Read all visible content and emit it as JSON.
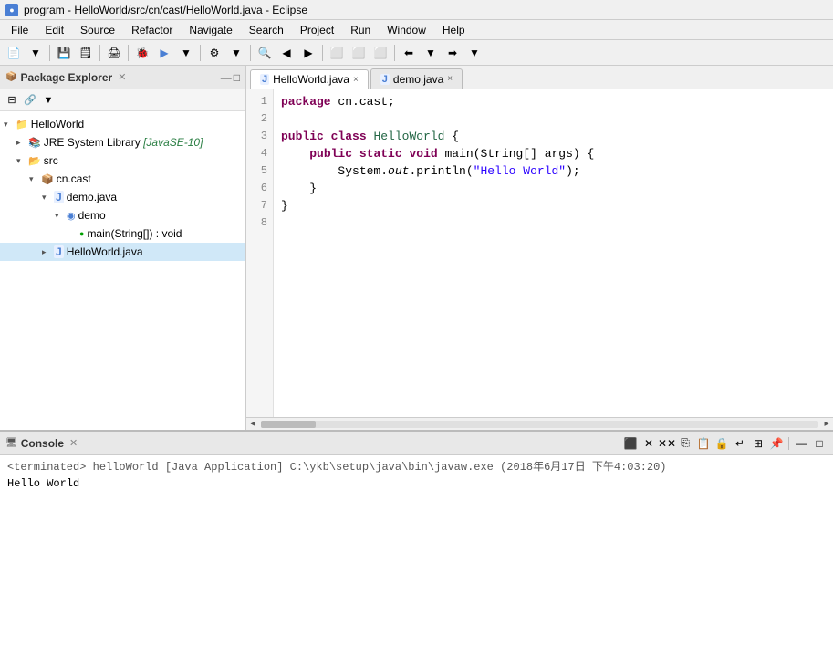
{
  "titleBar": {
    "icon": "●",
    "title": "program - HelloWorld/src/cn/cast/HelloWorld.java - Eclipse"
  },
  "menuBar": {
    "items": [
      "File",
      "Edit",
      "Source",
      "Refactor",
      "Navigate",
      "Search",
      "Project",
      "Run",
      "Window",
      "Help"
    ]
  },
  "packageExplorer": {
    "title": "Package Explorer",
    "closeLabel": "×",
    "tree": {
      "items": [
        {
          "id": "helloworld",
          "label": "HelloWorld",
          "indent": 0,
          "type": "project",
          "expanded": true
        },
        {
          "id": "jre",
          "label": "JRE System Library [JavaSE-10]",
          "indent": 1,
          "type": "jre",
          "expanded": false
        },
        {
          "id": "src",
          "label": "src",
          "indent": 1,
          "type": "folder",
          "expanded": true
        },
        {
          "id": "cn.cast",
          "label": "cn.cast",
          "indent": 2,
          "type": "package",
          "expanded": true
        },
        {
          "id": "demo.java",
          "label": "demo.java",
          "indent": 3,
          "type": "java",
          "expanded": true
        },
        {
          "id": "demo-class",
          "label": "demo",
          "indent": 4,
          "type": "class",
          "expanded": true
        },
        {
          "id": "main-method",
          "label": "main(String[]) : void",
          "indent": 5,
          "type": "method"
        },
        {
          "id": "HelloWorld.java",
          "label": "HelloWorld.java",
          "indent": 3,
          "type": "java",
          "expanded": false
        }
      ]
    }
  },
  "editor": {
    "tabs": [
      {
        "id": "helloworld-tab",
        "label": "HelloWorld.java",
        "active": true,
        "icon": "J"
      },
      {
        "id": "demo-tab",
        "label": "demo.java",
        "active": false,
        "icon": "J"
      }
    ],
    "code": {
      "lines": [
        {
          "num": 1,
          "content": "package cn.cast;"
        },
        {
          "num": 2,
          "content": ""
        },
        {
          "num": 3,
          "content": "public class HelloWorld {"
        },
        {
          "num": 4,
          "content": "\tpublic static void main(String[] args) {"
        },
        {
          "num": 5,
          "content": "\t\tSystem.out.println(\"Hello World\");"
        },
        {
          "num": 6,
          "content": "\t}"
        },
        {
          "num": 7,
          "content": "}"
        },
        {
          "num": 8,
          "content": ""
        }
      ]
    }
  },
  "console": {
    "title": "Console",
    "closeLabel": "×",
    "terminated": "<terminated> helloWorld [Java Application] C:\\ykb\\setup\\java\\bin\\javaw.exe (2018年6月17日 下午4:03:20)",
    "output": "Hello World"
  }
}
